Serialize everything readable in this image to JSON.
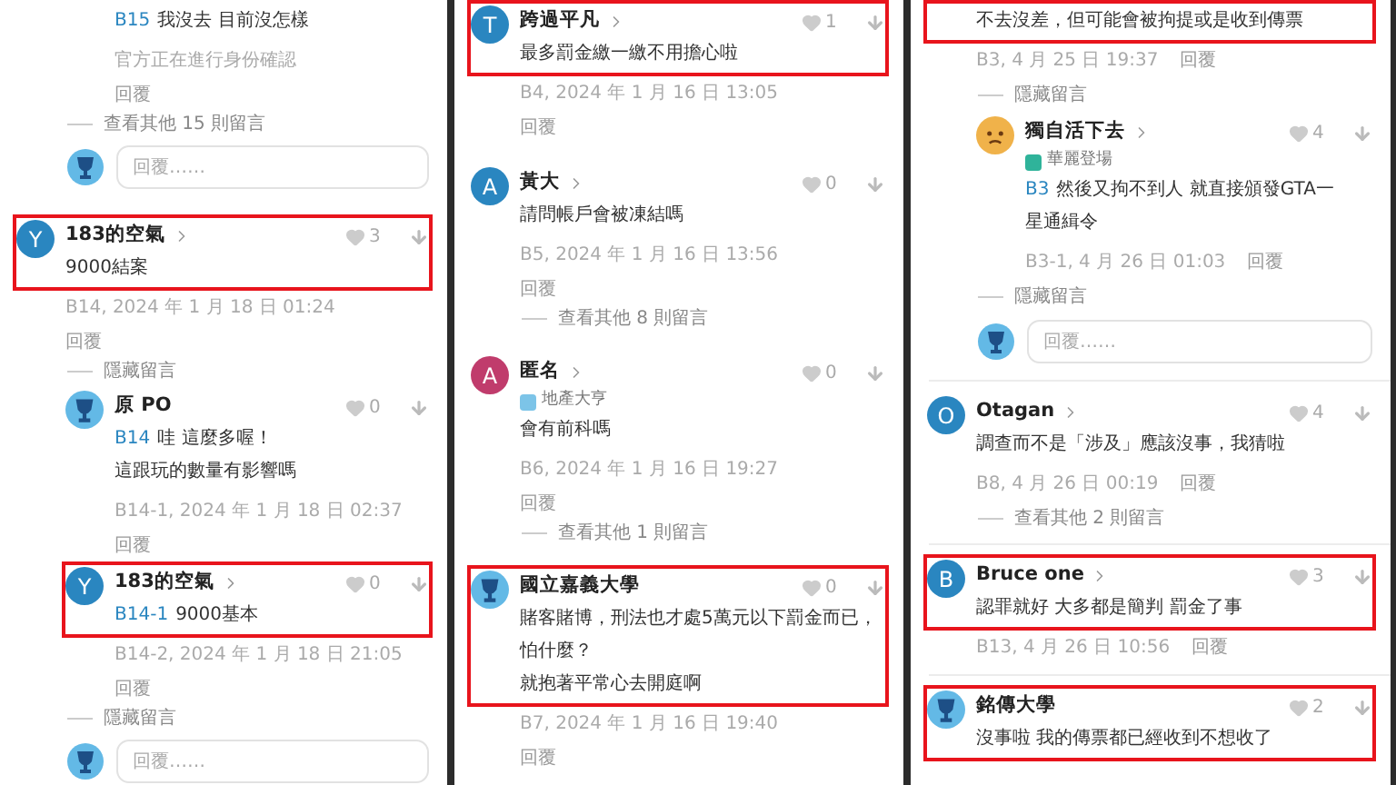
{
  "panels": [
    {
      "items": [
        {
          "kind": "comment",
          "nested": true,
          "highlighted": false,
          "body": [
            {
              "ref": "B15",
              "text": "我沒去 目前沒怎樣"
            }
          ],
          "meta": "官方正在進行身份確認",
          "reply": "回覆",
          "reply_inline": false
        },
        {
          "kind": "more",
          "text": "查看其他 15 則留言"
        },
        {
          "kind": "reply_box",
          "placeholder": "回覆……"
        },
        {
          "kind": "divider"
        },
        {
          "kind": "comment",
          "nested": false,
          "highlighted": true,
          "avatar": {
            "kind": "letter",
            "letter": "Y",
            "color": "#2a86c0"
          },
          "name": "183的空氣",
          "chevron": true,
          "likes": "3",
          "body": [
            {
              "text": "9000結案"
            }
          ],
          "meta": "B14, 2024 年 1 月 18 日 01:24",
          "reply": "回覆",
          "reply_inline": false
        },
        {
          "kind": "more",
          "text": "隱藏留言"
        },
        {
          "kind": "comment",
          "nested": true,
          "highlighted": false,
          "avatar": {
            "kind": "school"
          },
          "name": "原 PO",
          "chevron": false,
          "likes": "0",
          "body": [
            {
              "ref": "B14",
              "text": "哇 這麼多喔！"
            },
            {
              "text": "這跟玩的數量有影響嗎"
            }
          ],
          "meta": "B14-1, 2024 年 1 月 18 日 02:37",
          "reply": "回覆",
          "reply_inline": false
        },
        {
          "kind": "comment",
          "nested": true,
          "highlighted": true,
          "avatar": {
            "kind": "letter",
            "letter": "Y",
            "color": "#2a86c0"
          },
          "name": "183的空氣",
          "chevron": true,
          "likes": "0",
          "body": [
            {
              "ref": "B14-1",
              "text": "9000基本"
            }
          ],
          "meta": "B14-2, 2024 年 1 月 18 日 21:05",
          "reply": "回覆",
          "reply_inline": false
        },
        {
          "kind": "more",
          "text": "隱藏留言"
        },
        {
          "kind": "reply_box",
          "placeholder": "回覆……"
        }
      ]
    },
    {
      "items": [
        {
          "kind": "comment",
          "nested": false,
          "highlighted": true,
          "avatar": {
            "kind": "letter",
            "letter": "T",
            "color": "#2a86c0"
          },
          "name": "跨過平凡",
          "chevron": true,
          "likes": "1",
          "body": [
            {
              "text": "最多罰金繳一繳不用擔心啦"
            }
          ],
          "meta": "B4, 2024 年 1 月 16 日 13:05",
          "reply": "回覆",
          "reply_inline": false
        },
        {
          "kind": "divider"
        },
        {
          "kind": "comment",
          "nested": false,
          "highlighted": false,
          "avatar": {
            "kind": "letter",
            "letter": "A",
            "color": "#2a86c0"
          },
          "name": "黃大",
          "chevron": true,
          "likes": "0",
          "body": [
            {
              "text": "請問帳戶會被凍結嗎"
            }
          ],
          "meta": "B5, 2024 年 1 月 16 日 13:56",
          "reply": "回覆",
          "reply_inline": false
        },
        {
          "kind": "more",
          "text": "查看其他 8 則留言"
        },
        {
          "kind": "divider"
        },
        {
          "kind": "comment",
          "nested": false,
          "highlighted": false,
          "avatar": {
            "kind": "letter",
            "letter": "A",
            "color": "#c03c6c"
          },
          "name": "匿名",
          "chevron": true,
          "badge": {
            "text": "地產大亨",
            "color": "#7cc4e8"
          },
          "likes": "0",
          "body": [
            {
              "text": "會有前科嗎"
            }
          ],
          "meta": "B6, 2024 年 1 月 16 日 19:27",
          "reply": "回覆",
          "reply_inline": false
        },
        {
          "kind": "more",
          "text": "查看其他 1 則留言"
        },
        {
          "kind": "divider"
        },
        {
          "kind": "comment",
          "nested": false,
          "highlighted": true,
          "avatar": {
            "kind": "school"
          },
          "name": "國立嘉義大學",
          "chevron": false,
          "likes": "0",
          "body": [
            {
              "text": "賭客賭博，刑法也才處5萬元以下罰金而已，"
            },
            {
              "text": "怕什麼？"
            },
            {
              "text": "就抱著平常心去開庭啊"
            }
          ],
          "meta": "B7, 2024 年 1 月 16 日 19:40",
          "reply": "回覆",
          "reply_inline": false
        },
        {
          "kind": "divider"
        }
      ]
    },
    {
      "items": [
        {
          "kind": "comment",
          "nested": false,
          "highlighted": true,
          "body": [
            {
              "text": "不去沒差，但可能會被拘提或是收到傳票"
            }
          ],
          "meta": "B3, 4 月 25 日 19:37",
          "reply": "回覆",
          "reply_inline": true
        },
        {
          "kind": "more",
          "text": "隱藏留言"
        },
        {
          "kind": "comment",
          "nested": true,
          "highlighted": false,
          "avatar": {
            "kind": "sticker"
          },
          "name": "獨自活下去",
          "chevron": true,
          "badge": {
            "text": "華麗登場",
            "color": "#2fb39a"
          },
          "likes": "4",
          "body": [
            {
              "ref": "B3",
              "text": "然後又拘不到人 就直接頒發GTA一"
            },
            {
              "text": "星通緝令"
            }
          ],
          "meta": "B3-1, 4 月 26 日 01:03",
          "reply": "回覆",
          "reply_inline": true
        },
        {
          "kind": "more",
          "text": "隱藏留言"
        },
        {
          "kind": "reply_box",
          "placeholder": "回覆……"
        },
        {
          "kind": "divider"
        },
        {
          "kind": "comment",
          "nested": false,
          "highlighted": false,
          "avatar": {
            "kind": "letter",
            "letter": "O",
            "color": "#2a86c0"
          },
          "name": "Otagan",
          "chevron": true,
          "likes": "4",
          "body": [
            {
              "text": "調查而不是「涉及」應該沒事，我猜啦"
            }
          ],
          "meta": "B8, 4 月 26 日 00:19",
          "reply": "回覆",
          "reply_inline": true
        },
        {
          "kind": "more",
          "text": "查看其他 2 則留言"
        },
        {
          "kind": "divider"
        },
        {
          "kind": "comment",
          "nested": false,
          "highlighted": true,
          "avatar": {
            "kind": "letter",
            "letter": "B",
            "color": "#2a86c0"
          },
          "name": "Bruce one",
          "chevron": true,
          "likes": "3",
          "body": [
            {
              "text": "認罪就好 大多都是簡判 罰金了事"
            }
          ],
          "meta": "B13, 4 月 26 日 10:56",
          "reply": "回覆",
          "reply_inline": true
        },
        {
          "kind": "divider"
        },
        {
          "kind": "comment",
          "nested": false,
          "highlighted": true,
          "avatar": {
            "kind": "school"
          },
          "name": "銘傳大學",
          "chevron": false,
          "likes": "2",
          "body": [
            {
              "text": "沒事啦 我的傳票都已經收到不想收了"
            }
          ]
        }
      ]
    }
  ]
}
